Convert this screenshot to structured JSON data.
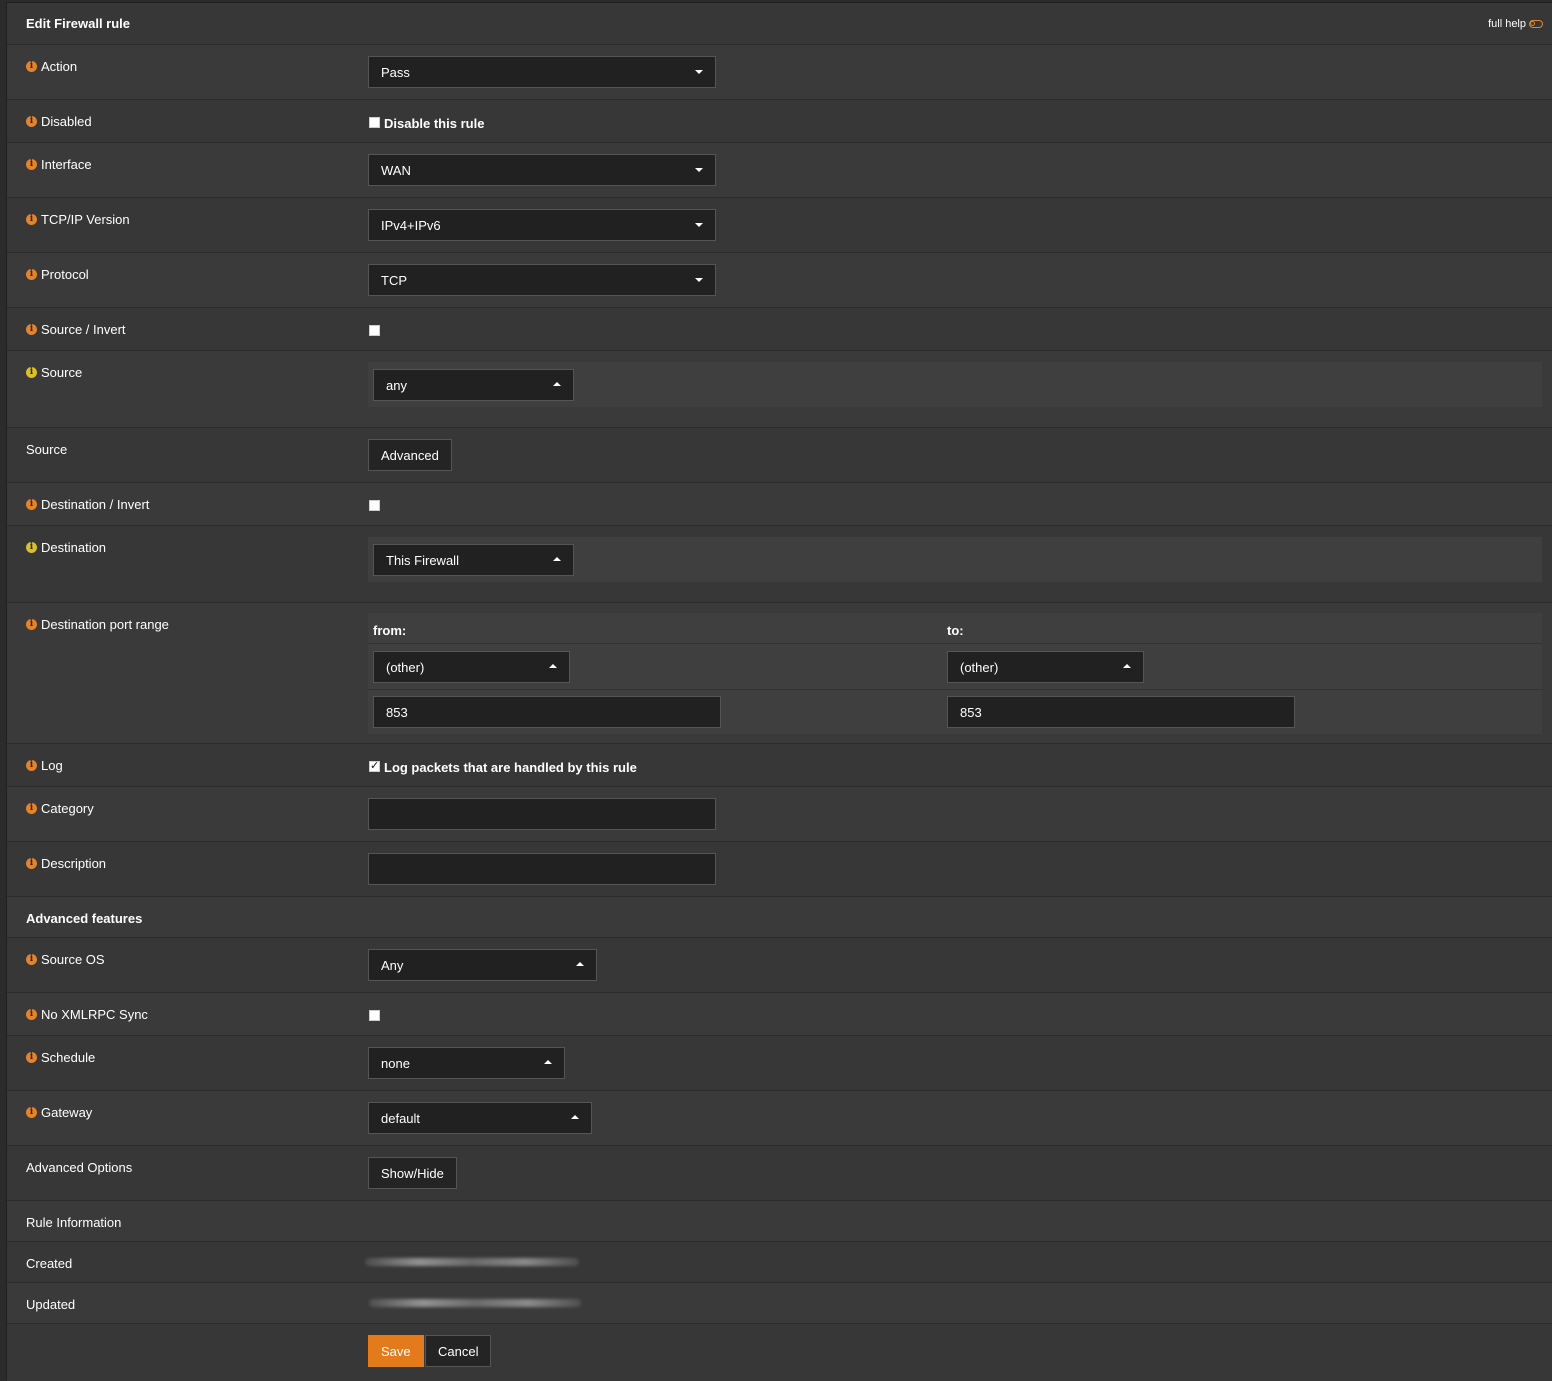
{
  "header": {
    "title": "Edit Firewall rule",
    "full_help": "full help"
  },
  "action": {
    "label": "Action",
    "value": "Pass"
  },
  "disabled": {
    "label": "Disabled",
    "checkbox_label": "Disable this rule"
  },
  "interface": {
    "label": "Interface",
    "value": "WAN"
  },
  "ipversion": {
    "label": "TCP/IP Version",
    "value": "IPv4+IPv6"
  },
  "protocol": {
    "label": "Protocol",
    "value": "TCP"
  },
  "source_invert": {
    "label": "Source / Invert"
  },
  "source": {
    "label": "Source",
    "value": "any"
  },
  "source_adv": {
    "label": "Source",
    "button": "Advanced"
  },
  "dest_invert": {
    "label": "Destination / Invert"
  },
  "destination": {
    "label": "Destination",
    "value": "This Firewall"
  },
  "port_range": {
    "label": "Destination port range",
    "from_label": "from:",
    "to_label": "to:",
    "from_select": "(other)",
    "to_select": "(other)",
    "from_value": "853",
    "to_value": "853"
  },
  "log": {
    "label": "Log",
    "checkbox_label": "Log packets that are handled by this rule",
    "checked": true
  },
  "category": {
    "label": "Category",
    "value": ""
  },
  "description": {
    "label": "Description",
    "value": ""
  },
  "advanced_features": {
    "label": "Advanced features"
  },
  "source_os": {
    "label": "Source OS",
    "value": "Any"
  },
  "no_xmlrpc": {
    "label": "No XMLRPC Sync"
  },
  "schedule": {
    "label": "Schedule",
    "value": "none"
  },
  "gateway": {
    "label": "Gateway",
    "value": "default"
  },
  "advanced_options": {
    "label": "Advanced Options",
    "button": "Show/Hide"
  },
  "rule_info": {
    "label": "Rule Information"
  },
  "created": {
    "label": "Created"
  },
  "updated": {
    "label": "Updated"
  },
  "footer": {
    "save": "Save",
    "cancel": "Cancel"
  },
  "colors": {
    "accent": "#e37a1c",
    "info_icon": "#e5832b",
    "info_icon_alt": "#d9c02a"
  }
}
